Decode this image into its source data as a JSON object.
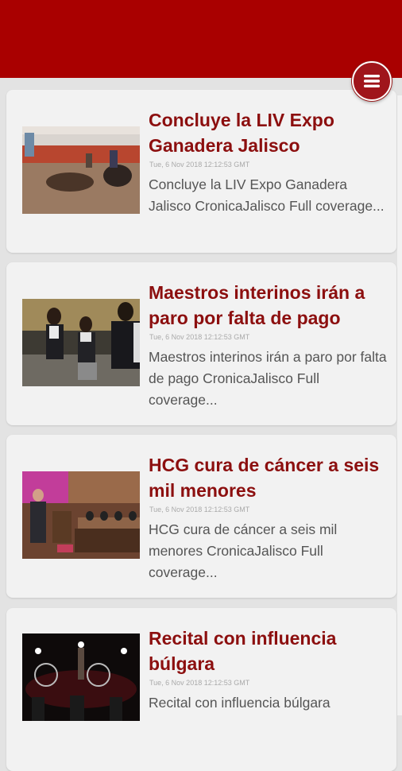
{
  "header": {
    "menu_icon": "hamburger-menu-icon",
    "brand_color": "#a90000"
  },
  "articles": [
    {
      "title": "Concluye la LIV Expo Ganadera Jalisco",
      "date": "Tue, 6 Nov 2018 12:12:53 GMT",
      "snippet": "Concluye la LIV Expo Ganadera Jalisco  CronicaJalisco  Full coverage..."
    },
    {
      "title": "Maestros interinos irán a paro por falta de pago",
      "date": "Tue, 6 Nov 2018 12:12:53 GMT",
      "snippet": "Maestros interinos irán a paro por falta de pago  CronicaJalisco  Full coverage..."
    },
    {
      "title": "HCG cura de cáncer a seis mil menores",
      "date": "Tue, 6 Nov 2018 12:12:53 GMT",
      "snippet": "HCG cura de cáncer a seis mil menores  CronicaJalisco  Full coverage..."
    },
    {
      "title": "Recital con influencia búlgara",
      "date": "Tue, 6 Nov 2018 12:12:53 GMT",
      "snippet": "Recital con influencia búlgara"
    }
  ]
}
